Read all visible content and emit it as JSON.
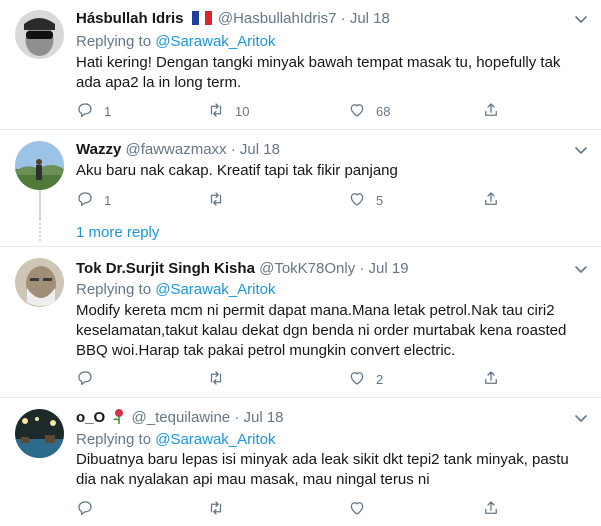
{
  "tweets": [
    {
      "name": "Hásbullah Idris",
      "handle": "@HasbullahIdris7",
      "dot": "·",
      "date": "Jul 18",
      "replying_prefix": "Replying to",
      "replying_to": "@Sarawak_Aritok",
      "text": "Hati kering! Dengan tangki minyak bawah tempat masak tu, hopefully tak ada apa2 la in long term.",
      "reply_count": "1",
      "retweet_count": "10",
      "like_count": "68"
    },
    {
      "name": "Wazzy",
      "handle": "@fawwazmaxx",
      "dot": "·",
      "date": "Jul 18",
      "text": "Aku baru nak cakap. Kreatif tapi tak fikir panjang",
      "reply_count": "1",
      "retweet_count": "",
      "like_count": "5"
    },
    {
      "name": "Tok Dr.Surjit Singh Kisha",
      "handle": "@TokK78Only",
      "dot": "·",
      "date": "Jul 19",
      "replying_prefix": "Replying to",
      "replying_to": "@Sarawak_Aritok",
      "text": "Modify kereta mcm ni permit dapat mana.Mana letak petrol.Nak tau ciri2 keselamatan,takut kalau dekat dgn benda ni order murtabak kena roasted BBQ woi.Harap tak pakai petrol mungkin convert electric.",
      "reply_count": "",
      "retweet_count": "",
      "like_count": "2"
    },
    {
      "name": "o_O",
      "handle": "@_tequilawine",
      "dot": "·",
      "date": "Jul 18",
      "replying_prefix": "Replying to",
      "replying_to": "@Sarawak_Aritok",
      "text": "Dibuatnya baru lepas isi minyak ada leak sikit dkt tepi2 tank minyak, pastu dia nak nyalakan api mau masak, mau ningal terus ni",
      "reply_count": "",
      "retweet_count": "",
      "like_count": ""
    }
  ],
  "more_replies": "1 more reply",
  "colors": {
    "accent": "#1b95e0",
    "muted": "#657786",
    "text": "#14171a",
    "border": "#e6ecf0"
  },
  "icons": [
    "reply-icon",
    "retweet-icon",
    "like-icon",
    "share-icon",
    "chevron-down-icon",
    "france-flag-icon",
    "rose-emoji-icon"
  ]
}
